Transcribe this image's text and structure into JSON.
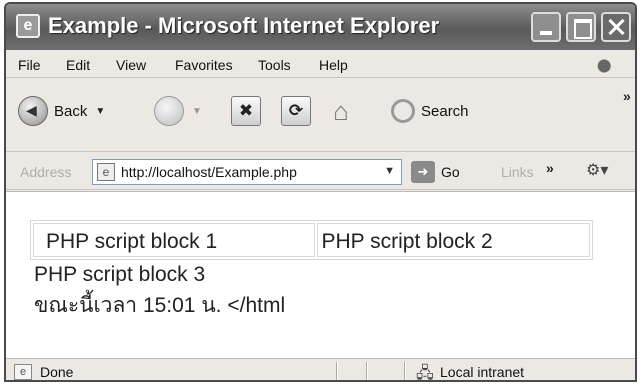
{
  "window": {
    "title": "Example - Microsoft Internet Explorer",
    "icon": "ie-logo-icon",
    "title_icon_glyph": "e"
  },
  "menu": {
    "items": [
      "File",
      "Edit",
      "View",
      "Favorites",
      "Tools",
      "Help"
    ]
  },
  "toolbar": {
    "back_label": "Back",
    "search_label": "Search",
    "overflow": "»",
    "icons": [
      "back-arrow-icon",
      "forward-arrow-icon",
      "stop-icon",
      "refresh-icon",
      "home-icon",
      "search-icon"
    ]
  },
  "address": {
    "label": "Address",
    "url": "http://localhost/Example.php",
    "go_label": "Go",
    "links_label": "Links",
    "links_overflow": "»"
  },
  "content": {
    "table_cells": [
      "PHP script block 1",
      "PHP script block 2"
    ],
    "line3": "PHP script block 3",
    "line4": "ขณะนี้เวลา 15:01 น. </html"
  },
  "status": {
    "text": "Done",
    "zone": "Local intranet"
  },
  "colors": {
    "titlebar": "#6e6e6e",
    "chrome": "#ece9e4",
    "content_bg": "#ffffff"
  }
}
